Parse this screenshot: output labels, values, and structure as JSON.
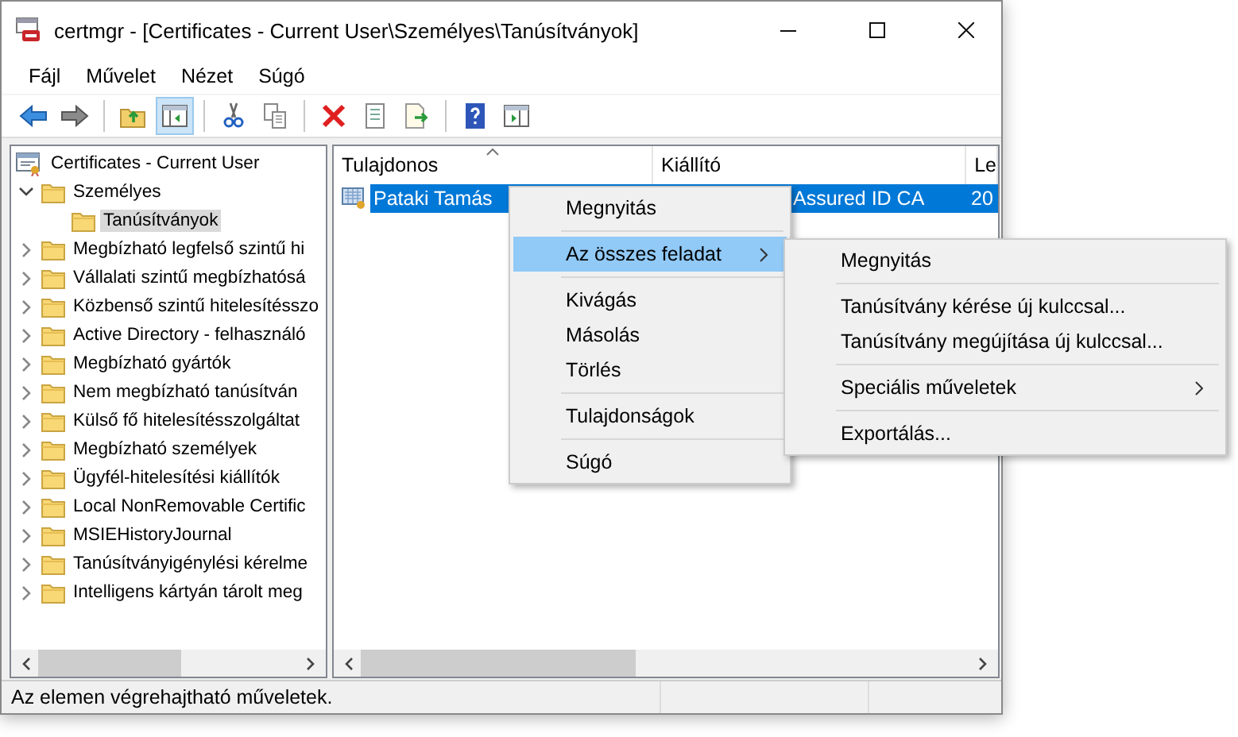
{
  "window": {
    "title": "certmgr - [Certificates - Current User\\Személyes\\Tanúsítványok]"
  },
  "menu_bar": [
    "Fájl",
    "Művelet",
    "Nézet",
    "Súgó"
  ],
  "toolbar": [
    {
      "kind": "button",
      "pressed": false
    },
    {
      "kind": "button",
      "pressed": false
    },
    {
      "kind": "separator"
    },
    {
      "kind": "button",
      "pressed": false
    },
    {
      "kind": "button",
      "pressed": true
    },
    {
      "kind": "separator"
    },
    {
      "kind": "button",
      "pressed": false
    },
    {
      "kind": "button",
      "pressed": false
    },
    {
      "kind": "separator"
    },
    {
      "kind": "button",
      "pressed": false
    },
    {
      "kind": "button",
      "pressed": false
    },
    {
      "kind": "button",
      "pressed": false
    },
    {
      "kind": "separator"
    },
    {
      "kind": "button",
      "pressed": false
    },
    {
      "kind": "button",
      "pressed": false
    }
  ],
  "tree": [
    {
      "label": "Certificates - Current User",
      "kind": "store",
      "selected": false,
      "children": [
        {
          "label": "Személyes",
          "kind": "folder",
          "expanded": true,
          "selected": false,
          "children": [
            {
              "label": "Tanúsítványok",
              "kind": "folder",
              "selected": true
            }
          ]
        },
        {
          "label": "Megbízható legfelső szintű hi",
          "kind": "folder",
          "expanded": false,
          "selected": false
        },
        {
          "label": "Vállalati szintű megbízhatósá",
          "kind": "folder",
          "expanded": false,
          "selected": false
        },
        {
          "label": "Közbenső szintű hitelesítésszo",
          "kind": "folder",
          "expanded": false,
          "selected": false
        },
        {
          "label": "Active Directory - felhasználó",
          "kind": "folder",
          "expanded": false,
          "selected": false
        },
        {
          "label": "Megbízható gyártók",
          "kind": "folder",
          "expanded": false,
          "selected": false
        },
        {
          "label": "Nem megbízható tanúsítván",
          "kind": "folder",
          "expanded": false,
          "selected": false
        },
        {
          "label": "Külső fő hitelesítésszolgáltat",
          "kind": "folder",
          "expanded": false,
          "selected": false
        },
        {
          "label": "Megbízható személyek",
          "kind": "folder",
          "expanded": false,
          "selected": false
        },
        {
          "label": "Ügyfél-hitelesítési kiállítók",
          "kind": "folder",
          "expanded": false,
          "selected": false
        },
        {
          "label": "Local NonRemovable Certific",
          "kind": "folder",
          "expanded": false,
          "selected": false
        },
        {
          "label": "MSIEHistoryJournal",
          "kind": "folder",
          "expanded": false,
          "selected": false
        },
        {
          "label": "Tanúsítványigénylési kérelme",
          "kind": "folder",
          "expanded": false,
          "selected": false
        },
        {
          "label": "Intelligens kártyán tárolt meg",
          "kind": "folder",
          "expanded": false,
          "selected": false
        }
      ]
    }
  ],
  "table": {
    "columns": [
      {
        "label": "Tulajdonos",
        "sorted": true
      },
      {
        "label": "Kiállító",
        "sorted": false
      },
      {
        "label": "Le",
        "sorted": false
      }
    ],
    "rows": [
      {
        "cells": [
          "Pataki Tamás",
          "Assured ID CA",
          "20"
        ],
        "selected": true
      }
    ]
  },
  "context_menu": [
    {
      "kind": "item",
      "label": "Megnyitás",
      "selected": false,
      "submenu": false
    },
    {
      "kind": "separator"
    },
    {
      "kind": "item",
      "label": "Az összes feladat",
      "selected": true,
      "submenu": true
    },
    {
      "kind": "separator"
    },
    {
      "kind": "item",
      "label": "Kivágás",
      "selected": false,
      "submenu": false
    },
    {
      "kind": "item",
      "label": "Másolás",
      "selected": false,
      "submenu": false
    },
    {
      "kind": "item",
      "label": "Törlés",
      "selected": false,
      "submenu": false
    },
    {
      "kind": "separator"
    },
    {
      "kind": "item",
      "label": "Tulajdonságok",
      "selected": false,
      "submenu": false
    },
    {
      "kind": "separator"
    },
    {
      "kind": "item",
      "label": "Súgó",
      "selected": false,
      "submenu": false
    }
  ],
  "submenu": [
    {
      "kind": "item",
      "label": "Megnyitás",
      "selected": false,
      "submenu": false
    },
    {
      "kind": "separator"
    },
    {
      "kind": "item",
      "label": "Tanúsítvány kérése új kulccsal...",
      "selected": false,
      "submenu": false
    },
    {
      "kind": "item",
      "label": "Tanúsítvány megújítása új kulccsal...",
      "selected": false,
      "submenu": false
    },
    {
      "kind": "separator"
    },
    {
      "kind": "item",
      "label": "Speciális műveletek",
      "selected": false,
      "submenu": true
    },
    {
      "kind": "separator"
    },
    {
      "kind": "item",
      "label": "Exportálás...",
      "selected": false,
      "submenu": false
    }
  ],
  "status_bar": "Az elemen végrehajtható műveletek."
}
